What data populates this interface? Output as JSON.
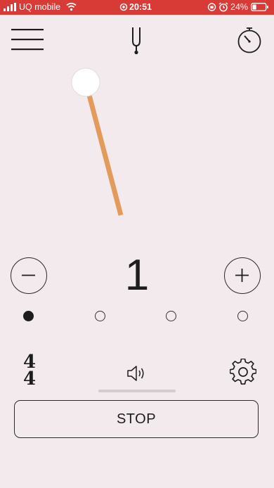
{
  "status_bar": {
    "carrier": "UQ mobile",
    "time": "20:51",
    "battery_percent": "24%",
    "background_color": "#d83a36"
  },
  "toolbar": {
    "menu_icon": "hamburger-menu-icon",
    "tuner_icon": "tuning-fork-icon",
    "timer_icon": "stopwatch-icon"
  },
  "pendulum": {
    "arm_color": "#e39b5c",
    "weight_color": "#ffffff"
  },
  "beat_counter": {
    "minus_label": "−",
    "current_beat": "1",
    "plus_label": "+",
    "beats_total": 4,
    "active_beat_index": 0
  },
  "bottom_controls": {
    "time_signature_top": "4",
    "time_signature_bottom": "4",
    "sound_icon": "speaker-icon",
    "settings_icon": "gear-icon"
  },
  "stop_button": {
    "label": "STOP"
  }
}
